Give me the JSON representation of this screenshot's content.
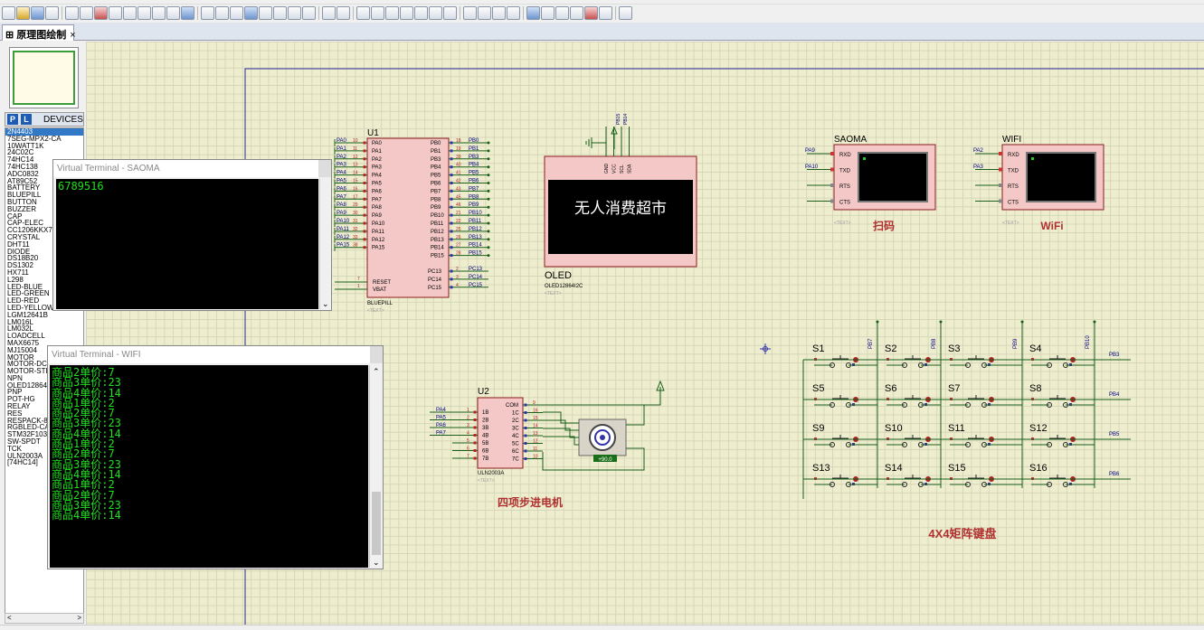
{
  "tab": {
    "label": "原理图绘制",
    "close": "×"
  },
  "devices": {
    "header": "DEVICES",
    "p": "P",
    "l": "L",
    "items": [
      "2N4403",
      "7SEG-MPX2-CA",
      "10WATT1K",
      "24C02C",
      "74HC14",
      "74HC138",
      "ADC0832",
      "AT89C52",
      "BATTERY",
      "BLUEPILL",
      "BUTTON",
      "BUZZER",
      "CAP",
      "CAP-ELEC",
      "CC1206KKX7R",
      "CRYSTAL",
      "DHT11",
      "DIODE",
      "DS18B20",
      "DS1302",
      "HX711",
      "L298",
      "LED-BLUE",
      "LED-GREEN",
      "LED-RED",
      "LED-YELLOW",
      "LGM12641B",
      "LM016L",
      "LM032L",
      "LOADCELL",
      "MAX6675",
      "MJ15004",
      "MOTOR",
      "MOTOR-DC",
      "MOTOR-STE",
      "NPN",
      "OLED12864",
      "PNP",
      "POT-HG",
      "RELAY",
      "RES",
      "RESPACK-8",
      "RGBLED-CA",
      "STM32F103",
      "SW-SPDT",
      "TCK",
      "ULN2003A",
      "[74HC14]"
    ]
  },
  "terminal_saoma": {
    "title": "Virtual Terminal - SAOMA",
    "lines": [
      "6789516"
    ]
  },
  "terminal_wifi": {
    "title": "Virtual Terminal - WIFI",
    "lines": [
      "商品2单价:7",
      "商品3单价:23",
      "商品4单价:14",
      "商品1单价:2",
      "商品2单价:7",
      "商品3单价:23",
      "商品4单价:14",
      "商品1单价:2",
      "商品2单价:7",
      "商品3单价:23",
      "商品4单价:14",
      "商品1单价:2",
      "商品2单价:7",
      "商品3单价:23",
      "商品4单价:14"
    ]
  },
  "u1": {
    "ref": "U1",
    "part": "BLUEPILL",
    "text": "<TEXT>",
    "left_pins": [
      "PA0",
      "PA1",
      "PA2",
      "PA3",
      "PA4",
      "PA5",
      "PA6",
      "PA7",
      "PA8",
      "PA9",
      "PA10",
      "PA11",
      "PA12",
      "PA15"
    ],
    "left_nums": [
      "10",
      "11",
      "12",
      "13",
      "14",
      "15",
      "16",
      "17",
      "29",
      "30",
      "31",
      "32",
      "33",
      "38"
    ],
    "right_pins": [
      "PB0",
      "PB1",
      "PB3",
      "PB4",
      "PB5",
      "PB6",
      "PB7",
      "PB8",
      "PB9",
      "PB10",
      "PB11",
      "PB12",
      "PB13",
      "PB14",
      "PB15"
    ],
    "right_nums": [
      "18",
      "19",
      "39",
      "40",
      "41",
      "42",
      "43",
      "45",
      "46",
      "21",
      "22",
      "25",
      "26",
      "27",
      "28"
    ],
    "right_nets": [
      "PB0",
      "PB1",
      "PB3",
      "PB4",
      "PB5",
      "PB6",
      "PB7",
      "PB8",
      "PB9",
      "PB10",
      "PB11",
      "PB12",
      "PB13",
      "PB14",
      "PB15"
    ],
    "pc_pins": [
      "PC13",
      "PC14",
      "PC15"
    ],
    "pc_nums": [
      "2",
      "3",
      "4"
    ],
    "pc_nets": [
      "PC13",
      "PC14",
      "PC15"
    ],
    "reset": "RESET",
    "vbat": "VBAT",
    "reset_num": "7",
    "vbat_num": "1"
  },
  "oled": {
    "ref": "OLED",
    "part": "OLED12864I2C",
    "text": "<TEXT>",
    "display": "无人消费超市",
    "pins": [
      "GND",
      "VCC",
      "SCL",
      "SDA"
    ],
    "nets": [
      "PB15",
      "PB14"
    ]
  },
  "saoma": {
    "ref": "SAOMA",
    "pins": [
      "RXD",
      "TXD",
      "RTS",
      "CTS"
    ],
    "nets": [
      "PA9",
      "PA10"
    ],
    "caption": "扫码",
    "text": "<TEXT>"
  },
  "wifi": {
    "ref": "WIFI",
    "pins": [
      "RXD",
      "TXD",
      "RTS",
      "CTS"
    ],
    "nets": [
      "PA2",
      "PA3"
    ],
    "caption": "WiFi",
    "text": "<TEXT>"
  },
  "u2": {
    "ref": "U2",
    "part": "ULN2003A",
    "text": "<TEXT>",
    "caption": "四项步进电机",
    "left_pins": [
      "1B",
      "2B",
      "3B",
      "4B",
      "5B",
      "6B",
      "7B"
    ],
    "left_nums": [
      "1",
      "2",
      "3",
      "4",
      "5",
      "6",
      "7"
    ],
    "right_pins": [
      "COM",
      "1C",
      "2C",
      "3C",
      "4C",
      "5C",
      "6C",
      "7C"
    ],
    "right_nums": [
      "9",
      "16",
      "15",
      "14",
      "13",
      "12",
      "11",
      "10"
    ],
    "nets": [
      "PA4",
      "PA5",
      "PA6",
      "PA7"
    ],
    "motor_value": "+90.0"
  },
  "keypad": {
    "caption": "4X4矩阵键盘",
    "keys": [
      "S1",
      "S2",
      "S3",
      "S4",
      "S5",
      "S6",
      "S7",
      "S8",
      "S9",
      "S10",
      "S11",
      "S12",
      "S13",
      "S14",
      "S15",
      "S16"
    ],
    "col_nets": [
      "PB7",
      "PB8",
      "PB9",
      "PB10"
    ],
    "row_nets": [
      "PB3",
      "PB4",
      "PB5",
      "PB6"
    ]
  },
  "colors": {
    "wire": "#1a5e1a",
    "body": "#f5c8c8",
    "body_border": "#8b1a1a",
    "label": "#000080",
    "caption": "#b03030",
    "term": "#20e020"
  }
}
